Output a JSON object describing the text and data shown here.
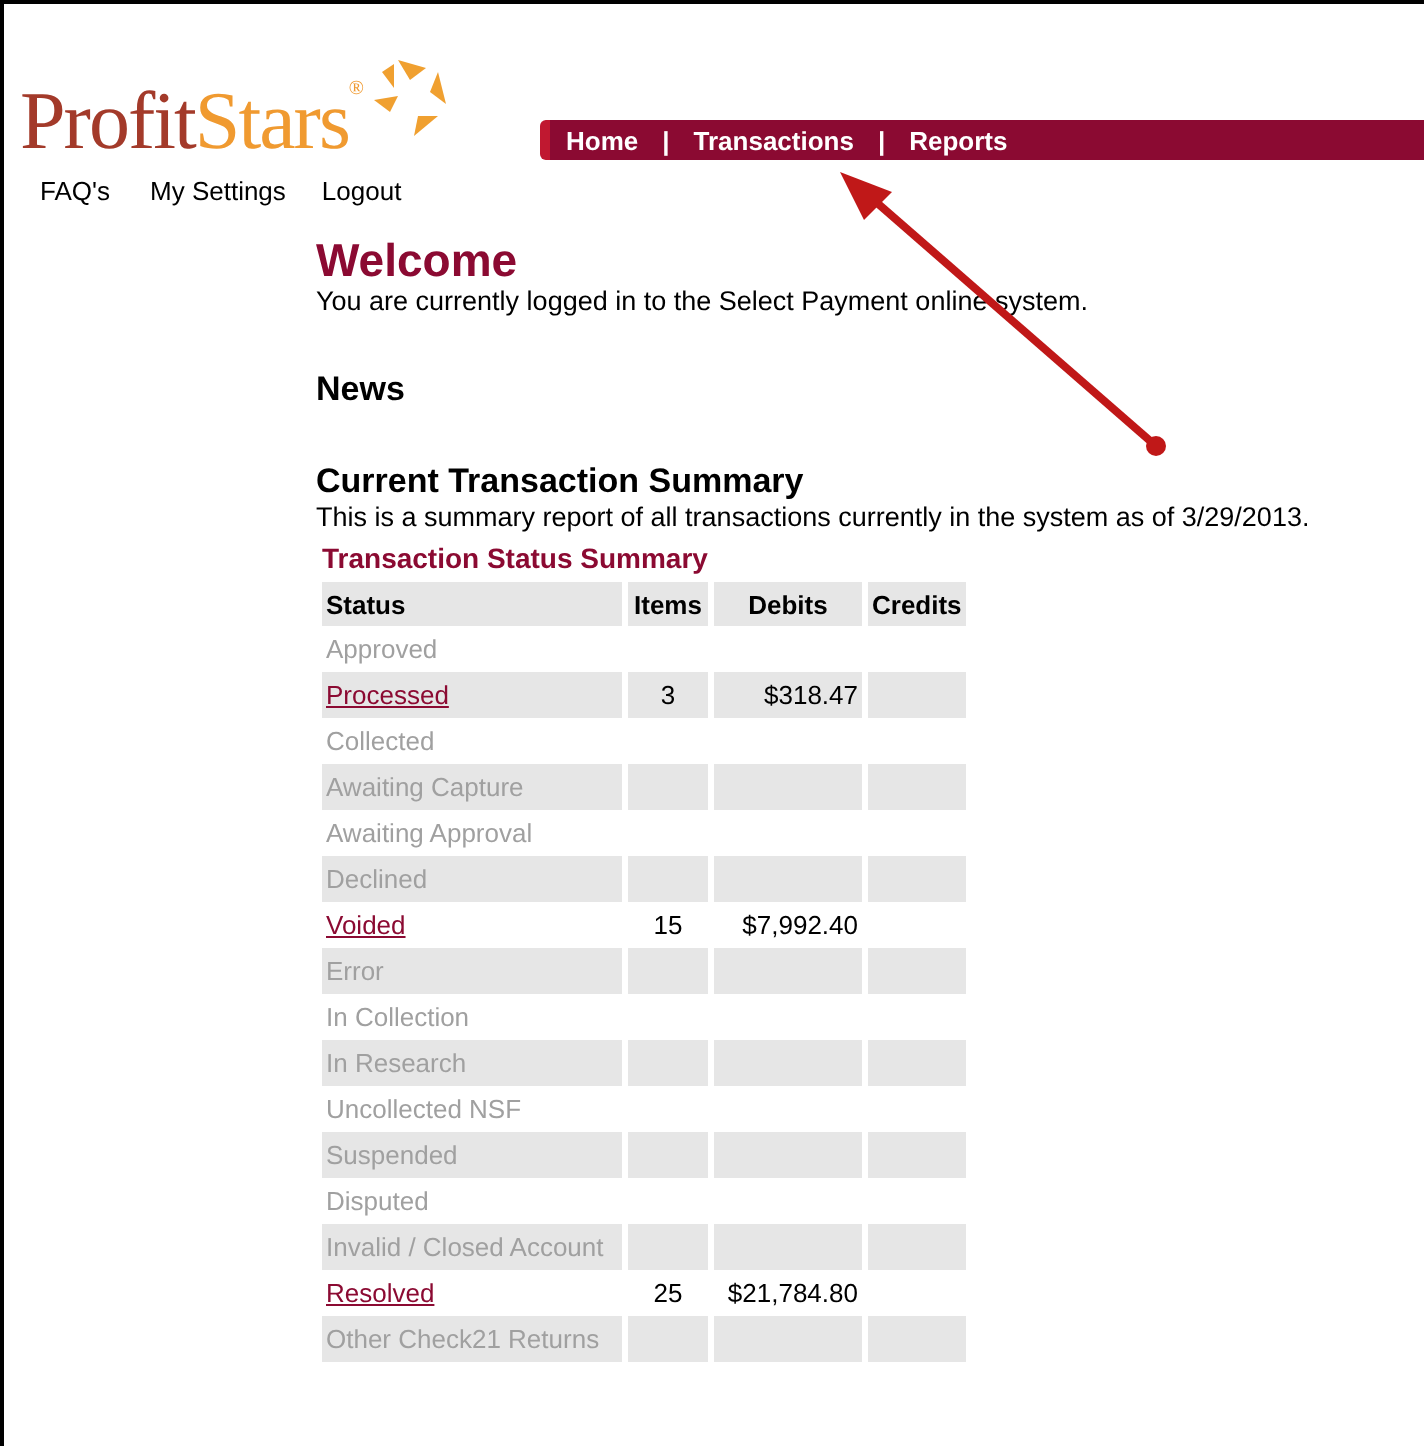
{
  "logo": {
    "parts": [
      "Profit",
      "Stars"
    ],
    "mark": "®"
  },
  "nav": {
    "items": [
      "Home",
      "Transactions",
      "Reports"
    ],
    "separator": "|"
  },
  "user_links": [
    "FAQ's",
    "My Settings",
    "Logout"
  ],
  "welcome": {
    "title": "Welcome",
    "text": "You are currently logged in to the Select Payment online system."
  },
  "news": {
    "title": "News"
  },
  "summary": {
    "title": "Current Transaction Summary",
    "text": "This is a summary report of all transactions currently in the system as of 3/29/2013.",
    "table_title": "Transaction Status Summary",
    "columns": [
      "Status",
      "Items",
      "Debits",
      "Credits"
    ],
    "rows": [
      {
        "status": "Approved",
        "linked": false
      },
      {
        "status": "Processed",
        "linked": true,
        "items": "3",
        "debits": "$318.47"
      },
      {
        "status": "Collected",
        "linked": false
      },
      {
        "status": "Awaiting Capture",
        "linked": false
      },
      {
        "status": "Awaiting Approval",
        "linked": false
      },
      {
        "status": "Declined",
        "linked": false
      },
      {
        "status": "Voided",
        "linked": true,
        "items": "15",
        "debits": "$7,992.40"
      },
      {
        "status": "Error",
        "linked": false
      },
      {
        "status": "In Collection",
        "linked": false
      },
      {
        "status": "In Research",
        "linked": false
      },
      {
        "status": "Uncollected NSF",
        "linked": false
      },
      {
        "status": "Suspended",
        "linked": false
      },
      {
        "status": "Disputed",
        "linked": false
      },
      {
        "status": "Invalid / Closed Account",
        "linked": false
      },
      {
        "status": "Resolved",
        "linked": true,
        "items": "25",
        "debits": "$21,784.80"
      },
      {
        "status": "Other Check21 Returns",
        "linked": false
      }
    ]
  }
}
